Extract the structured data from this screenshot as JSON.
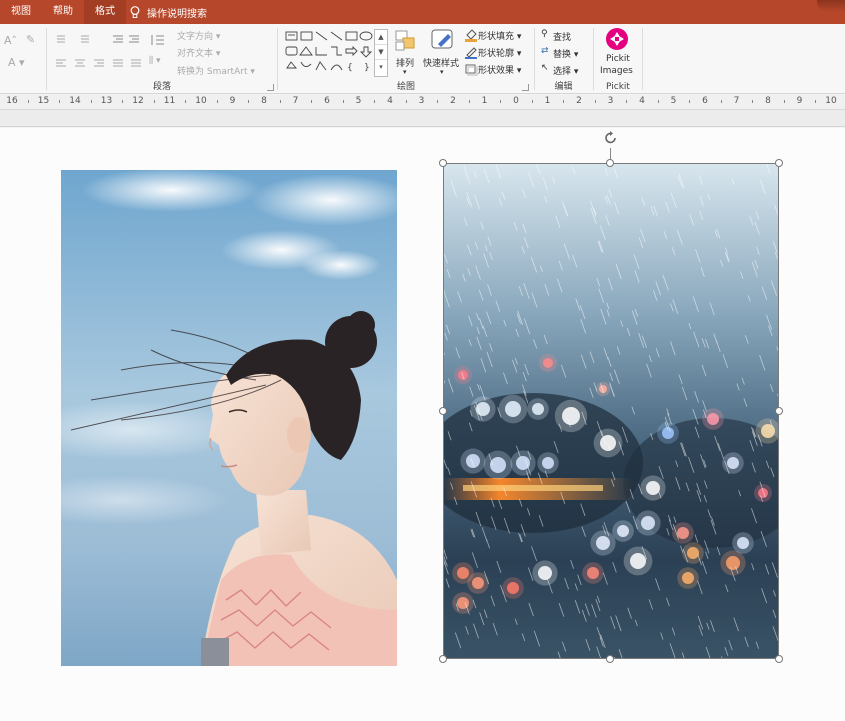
{
  "tabs": [
    {
      "label": "视图"
    },
    {
      "label": "帮助"
    },
    {
      "label": "格式",
      "active": true
    }
  ],
  "tell_me": "操作说明搜索",
  "ribbon": {
    "paragraph": {
      "text_direction": "文字方向",
      "align_text": "对齐文本",
      "convert_smartart": "转换为 SmartArt",
      "label": "段落"
    },
    "drawing": {
      "arrange": "排列",
      "quick_styles": "快速样式",
      "shape_fill": "形状填充",
      "shape_outline": "形状轮廓",
      "shape_effects": "形状效果",
      "label": "绘图"
    },
    "editing": {
      "find": "查找",
      "replace": "替换",
      "select": "选择",
      "label": "编辑"
    },
    "pickit": {
      "button_line1": "Pickit",
      "button_line2": "Images",
      "label": "Pickit"
    }
  },
  "ruler": {
    "labels": [
      "16",
      "15",
      "14",
      "13",
      "12",
      "11",
      "10",
      "9",
      "8",
      "7",
      "6",
      "5",
      "4",
      "3",
      "2",
      "1",
      "0",
      "1",
      "2",
      "3",
      "4",
      "5",
      "6",
      "7",
      "8",
      "9",
      "10"
    ]
  },
  "colors": {
    "accent": "#b7472a",
    "active_tab": "#a33d23",
    "pickit": "#e4007f",
    "fill_bar": "#e8a33a",
    "outline_bar": "#4472c4"
  },
  "images": [
    {
      "name": "woman-portrait-photo"
    },
    {
      "name": "rainy-city-night-photo",
      "selected": true
    }
  ]
}
